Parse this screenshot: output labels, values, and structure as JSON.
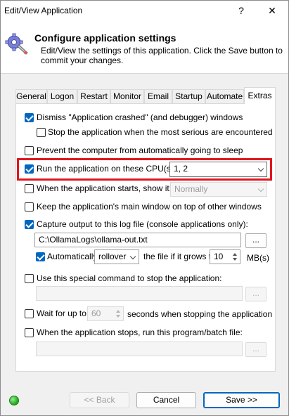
{
  "window": {
    "title": "Edit/View Application",
    "help_glyph": "?",
    "close_glyph": "✕"
  },
  "header": {
    "title": "Configure application settings",
    "description": "Edit/View the settings of this application. Click the Save button to commit your changes."
  },
  "tabs": [
    {
      "label": "General"
    },
    {
      "label": "Logon"
    },
    {
      "label": "Restart"
    },
    {
      "label": "Monitor"
    },
    {
      "label": "Email"
    },
    {
      "label": "Startup"
    },
    {
      "label": "Automate"
    },
    {
      "label": "Extras",
      "active": true
    }
  ],
  "extras": {
    "dismiss_crashed": {
      "label": "Dismiss \"Application crashed\" (and debugger) windows",
      "checked": true
    },
    "stop_on_serious": {
      "label": "Stop the application when the most serious are encountered",
      "checked": false
    },
    "prevent_sleep": {
      "label": "Prevent the computer from automatically going to sleep",
      "checked": false
    },
    "run_on_cpus": {
      "label": "Run the application on these CPU(s):",
      "checked": true,
      "value": "1, 2"
    },
    "show_on_start": {
      "label": "When the application starts, show it:",
      "checked": false,
      "value": "Normally"
    },
    "keep_on_top": {
      "label": "Keep the application's main window on top of other windows",
      "checked": false
    },
    "capture_output": {
      "label": "Capture output to this log file (console applications only):",
      "checked": true,
      "path": "C:\\OllamaLogs\\ollama-out.txt",
      "browse": "..."
    },
    "auto_rotate": {
      "label": "Automatically",
      "checked": true,
      "mode": "rollover",
      "mid_label": "the file if it grows to",
      "size": "10",
      "unit": "MB(s)"
    },
    "stop_command": {
      "label": "Use this special command to stop the application:",
      "checked": false,
      "value": "",
      "browse": "..."
    },
    "wait_for": {
      "label": "Wait for up to:",
      "checked": false,
      "value": "60",
      "suffix": "seconds when stopping the application"
    },
    "on_stop_run": {
      "label": "When the application stops, run this program/batch file:",
      "checked": false,
      "value": "",
      "browse": "..."
    }
  },
  "footer": {
    "back": "<< Back",
    "cancel": "Cancel",
    "save": "Save >>"
  },
  "colors": {
    "accent": "#0067c0",
    "highlight": "#e0161e",
    "status": "#1fa31a"
  }
}
